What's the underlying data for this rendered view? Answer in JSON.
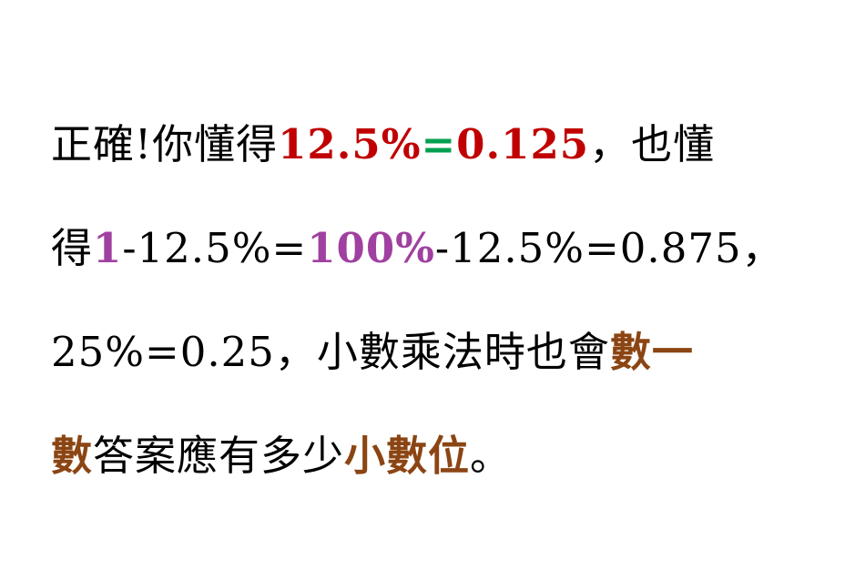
{
  "lines": [
    {
      "segments": [
        {
          "text": "正確!你懂得",
          "style": "plain"
        },
        {
          "text": "12.5%",
          "style": "red"
        },
        {
          "text": "=",
          "style": "green"
        },
        {
          "text": "0.125",
          "style": "red"
        },
        {
          "text": "，也懂",
          "style": "plain"
        }
      ]
    },
    {
      "segments": [
        {
          "text": "得",
          "style": "plain"
        },
        {
          "text": "1",
          "style": "purple"
        },
        {
          "text": "-12.5%=",
          "style": "plain"
        },
        {
          "text": "100%",
          "style": "purple"
        },
        {
          "text": "-12.5%=0.875，",
          "style": "plain"
        }
      ]
    },
    {
      "segments": [
        {
          "text": "25%=0.25，小數乘法時也會",
          "style": "plain"
        },
        {
          "text": "數一",
          "style": "brown"
        }
      ]
    },
    {
      "segments": [
        {
          "text": "數",
          "style": "brown"
        },
        {
          "text": "答案應有多少",
          "style": "plain"
        },
        {
          "text": "小數位",
          "style": "brown"
        },
        {
          "text": "。",
          "style": "plain"
        }
      ]
    }
  ],
  "colors": {
    "red": "#c00000",
    "green": "#00a050",
    "purple": "#a040a0",
    "brown": "#8b4513",
    "text": "#000000",
    "background": "#ffffff"
  }
}
